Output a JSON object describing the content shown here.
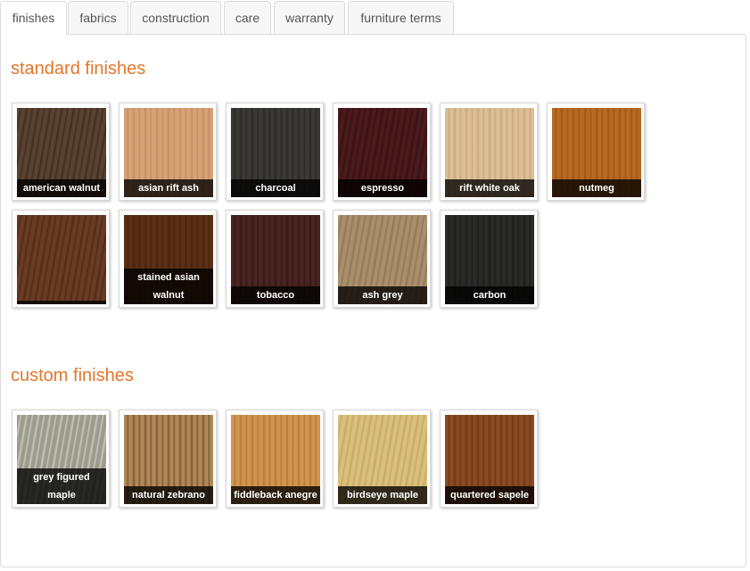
{
  "tabs": [
    {
      "label": "finishes",
      "active": true
    },
    {
      "label": "fabrics"
    },
    {
      "label": "construction"
    },
    {
      "label": "care"
    },
    {
      "label": "warranty"
    },
    {
      "label": "furniture terms"
    }
  ],
  "standard": {
    "title": "standard finishes",
    "items": [
      {
        "label": "american walnut",
        "base": "#5a4232",
        "grain": "#3e2c20"
      },
      {
        "label": "asian rift ash",
        "base": "#d8a277",
        "grain": "#c58c60"
      },
      {
        "label": "charcoal",
        "base": "#3b3936",
        "grain": "#2a2826"
      },
      {
        "label": "espresso",
        "base": "#4a1a1d",
        "grain": "#361114"
      },
      {
        "label": "rift white oak",
        "base": "#dcbf96",
        "grain": "#c9a97c"
      },
      {
        "label": "nutmeg",
        "base": "#b86a22",
        "grain": "#9c5716"
      },
      {
        "label": "",
        "base": "#6a3c22",
        "grain": "#4e2a16"
      },
      {
        "label": "stained asian walnut",
        "base": "#5a2f16",
        "grain": "#46230e"
      },
      {
        "label": "tobacco",
        "base": "#4a2420",
        "grain": "#351815"
      },
      {
        "label": "ash grey",
        "base": "#a98f6c",
        "grain": "#917657"
      },
      {
        "label": "carbon",
        "base": "#2a2b27",
        "grain": "#1c1d1a"
      }
    ]
  },
  "custom": {
    "title": "custom finishes",
    "items": [
      {
        "label": "grey figured maple",
        "base": "#9c9a8d",
        "grain": "#c9c8bd"
      },
      {
        "label": "natural zebrano",
        "base": "#b08858",
        "grain": "#7a5834"
      },
      {
        "label": "fiddleback anegre",
        "base": "#d0954f",
        "grain": "#b57a38"
      },
      {
        "label": "birdseye maple",
        "base": "#d9c07c",
        "grain": "#c4a862"
      },
      {
        "label": "quartered sapele",
        "base": "#8a4a22",
        "grain": "#6e3716"
      }
    ]
  }
}
